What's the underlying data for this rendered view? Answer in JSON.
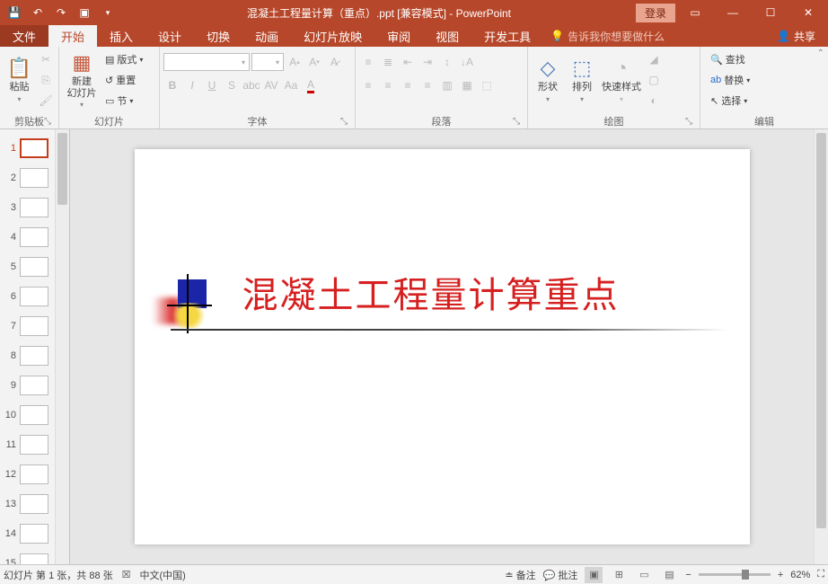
{
  "title_bar": {
    "document_title": "混凝土工程量计算（重点）.ppt [兼容模式] - PowerPoint",
    "login": "登录"
  },
  "menu": {
    "file": "文件",
    "home": "开始",
    "insert": "插入",
    "design": "设计",
    "transitions": "切换",
    "animations": "动画",
    "slideshow": "幻灯片放映",
    "review": "审阅",
    "view": "视图",
    "developer": "开发工具",
    "tell_me": "告诉我你想要做什么",
    "share": "共享"
  },
  "ribbon": {
    "clipboard": {
      "label": "剪贴板",
      "paste": "粘贴"
    },
    "slides": {
      "label": "幻灯片",
      "new_slide": "新建\n幻灯片",
      "layout": "版式",
      "reset": "重置",
      "section": "节"
    },
    "font": {
      "label": "字体"
    },
    "paragraph": {
      "label": "段落"
    },
    "drawing": {
      "label": "绘图",
      "shapes": "形状",
      "arrange": "排列",
      "quick_styles": "快速样式"
    },
    "editing": {
      "label": "编辑",
      "find": "查找",
      "replace": "替换",
      "select": "选择"
    }
  },
  "slide": {
    "title_text": "混凝土工程量计算重点"
  },
  "thumbnails": {
    "count": 15,
    "selected": 1
  },
  "status": {
    "slide_info": "幻灯片 第 1 张，共 88 张",
    "language": "中文(中国)",
    "notes": "备注",
    "comments": "批注",
    "zoom": "62%"
  }
}
